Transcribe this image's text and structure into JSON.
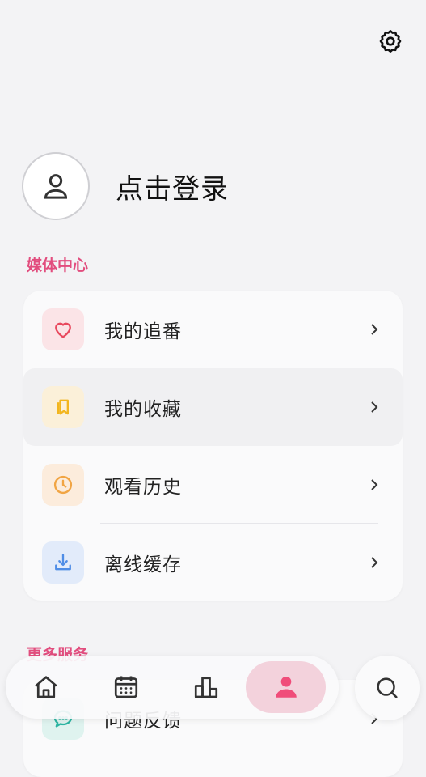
{
  "profile": {
    "login_label": "点击登录"
  },
  "media_center": {
    "title": "媒体中心",
    "items": [
      {
        "label": "我的追番",
        "icon": "heart-icon",
        "color": "#e8495e",
        "bg": "#fbe4e7"
      },
      {
        "label": "我的收藏",
        "icon": "bookmark-icon",
        "color": "#f2b61f",
        "bg": "#fbf0d9"
      },
      {
        "label": "观看历史",
        "icon": "clock-icon",
        "color": "#f1a544",
        "bg": "#fcecdc"
      },
      {
        "label": "离线缓存",
        "icon": "download-icon",
        "color": "#4f8de6",
        "bg": "#e2ebfa"
      }
    ]
  },
  "more_services": {
    "title": "更多服务",
    "items": [
      {
        "label": "问题反馈",
        "icon": "chat-icon",
        "color": "#2cb5a2",
        "bg": "#dff3ef"
      }
    ]
  },
  "colors": {
    "accent": "#e24d7e",
    "nav_active": "#f04d7a"
  },
  "nav": {
    "items": [
      "home-icon",
      "calendar-icon",
      "chart-icon",
      "user-icon"
    ],
    "active": "user-icon"
  }
}
